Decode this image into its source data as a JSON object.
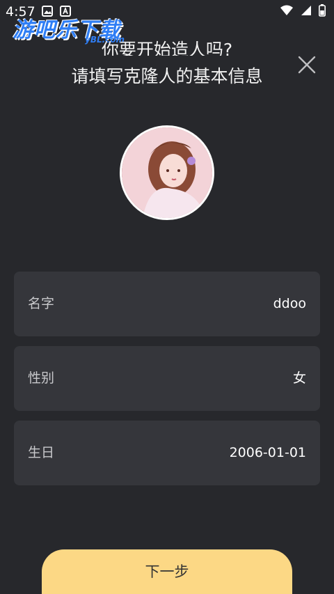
{
  "status_bar": {
    "time": "4:57",
    "left_icons": [
      "image-icon",
      "text-a-icon"
    ],
    "right_icons": [
      "wifi-icon",
      "signal-icon",
      "battery-icon"
    ]
  },
  "watermark": {
    "main": "游吧乐下载",
    "sub": "yBL.com"
  },
  "header": {
    "line1": "你要开始造人吗?",
    "line2": "请填写克隆人的基本信息",
    "close_icon": "close-icon"
  },
  "avatar": {
    "icon": "avatar-image"
  },
  "form": {
    "fields": [
      {
        "label": "名字",
        "value": "ddoo"
      },
      {
        "label": "性别",
        "value": "女"
      },
      {
        "label": "生日",
        "value": "2006-01-01"
      }
    ]
  },
  "footer": {
    "next_label": "下一步"
  },
  "colors": {
    "background": "#27282c",
    "field_bg": "#35363b",
    "button_bg": "#fcd885",
    "watermark": "#2f7ef5"
  }
}
